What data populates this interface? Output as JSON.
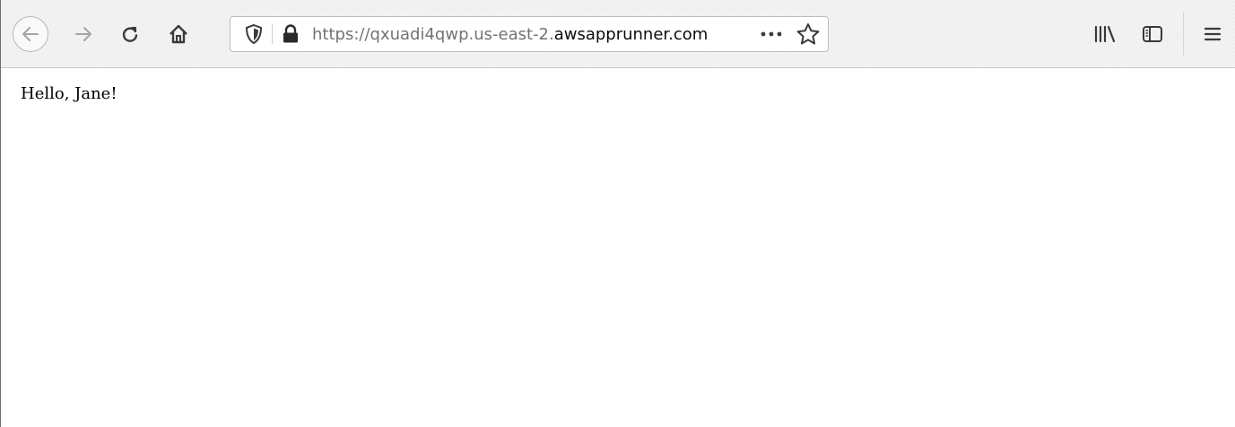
{
  "browser": {
    "url": {
      "prefix": "https://qxuadi4qwp.us-east-2.",
      "domain": "awsapprunner.com"
    },
    "icons": {
      "back": "back-arrow-icon",
      "forward": "forward-arrow-icon",
      "reload": "reload-icon",
      "home": "home-icon",
      "tracking": "shield-icon",
      "secure": "lock-icon",
      "page_actions": "more-dots-icon",
      "bookmark": "star-icon",
      "library": "library-icon",
      "sidebar": "sidebar-icon",
      "menu": "hamburger-menu-icon"
    }
  },
  "page": {
    "greeting": "Hello, Jane!"
  }
}
